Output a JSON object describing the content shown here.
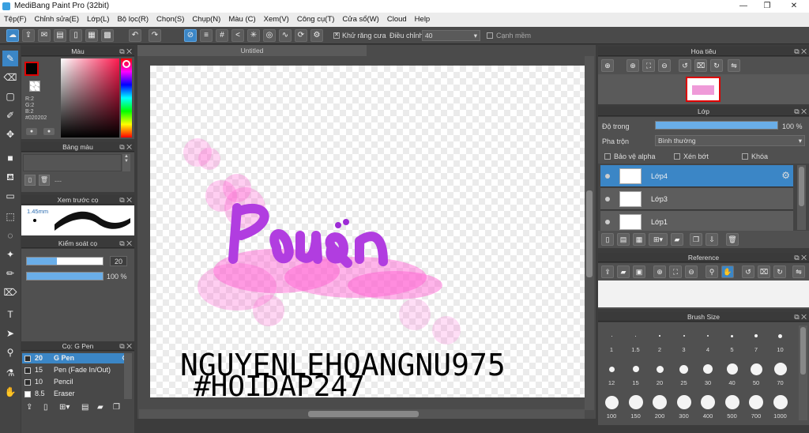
{
  "app": {
    "title": "MediBang Paint Pro (32bit)"
  },
  "menu": [
    "Tệp(F)",
    "Chỉnh sửa(E)",
    "Lớp(L)",
    "Bộ lọc(R)",
    "Chọn(S)",
    "Chụp(N)",
    "Màu (C)",
    "Xem(V)",
    "Công cụ(T)",
    "Cửa sổ(W)",
    "Cloud",
    "Help"
  ],
  "toolbar": {
    "antialias_label": "Khử răng cưa",
    "adjust_label": "Điều chỉnh",
    "adjust_value": "40",
    "edge_label": "Cạnh mềm"
  },
  "color_panel": {
    "title": "Màu",
    "r": "R:2",
    "g": "G:2",
    "b": "B:2",
    "hex": "#020202"
  },
  "palette_panel": {
    "title": "Bảng màu",
    "empty": "---"
  },
  "brush_preview": {
    "title": "Xem trước cọ",
    "size": "1.45mm"
  },
  "brush_control": {
    "title": "Kiểm soát cọ",
    "size_value": "20",
    "opacity_value": "100 %"
  },
  "brush_list": {
    "title": "Cọ: G Pen",
    "items": [
      {
        "size": "20",
        "name": "G Pen"
      },
      {
        "size": "15",
        "name": "Pen (Fade In/Out)"
      },
      {
        "size": "10",
        "name": "Pencil"
      },
      {
        "size": "8.5",
        "name": "Eraser"
      }
    ]
  },
  "canvas": {
    "tab": "Untitled",
    "handwriting_line1": "NGUYENLEHOANGNU975",
    "handwriting_line2": "#HOIDAP247"
  },
  "navigator": {
    "title": "Hoa tiêu"
  },
  "layer_panel": {
    "title": "Lớp",
    "opacity_label": "Độ trong",
    "opacity_value": "100 %",
    "opacity_fraction": 1.0,
    "blend_label": "Pha trộn",
    "blend_value": "Bình thường",
    "protect_alpha": "Bảo vệ alpha",
    "clipping": "Xén bớt",
    "lock": "Khóa",
    "layers": [
      "Lớp4",
      "Lớp3",
      "Lớp1"
    ]
  },
  "reference": {
    "title": "Reference"
  },
  "brush_size": {
    "title": "Brush Size",
    "sizes": [
      "1",
      "1.5",
      "2",
      "3",
      "4",
      "5",
      "7",
      "10",
      "12",
      "15",
      "20",
      "25",
      "30",
      "40",
      "50",
      "70",
      "100",
      "150",
      "200",
      "300",
      "400",
      "500",
      "700",
      "1000"
    ]
  },
  "colors": {
    "accent": "#3b86c6",
    "panel_bg": "#505050",
    "header_bg": "#3a3a3a"
  }
}
